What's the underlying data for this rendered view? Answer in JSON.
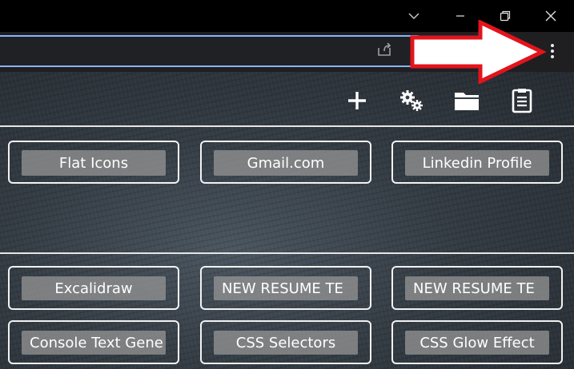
{
  "window_controls": [
    {
      "name": "tab-search",
      "icon": "chevron-down-icon"
    },
    {
      "name": "minimize",
      "icon": "minimize-icon"
    },
    {
      "name": "restore",
      "icon": "restore-icon"
    },
    {
      "name": "close",
      "icon": "close-icon"
    }
  ],
  "toolbar": {
    "share_icon": "share-icon",
    "menu_icon": "vertical-dots-icon"
  },
  "tools": [
    {
      "name": "add",
      "icon": "plus-icon"
    },
    {
      "name": "settings",
      "icon": "gears-icon"
    },
    {
      "name": "folder",
      "icon": "folder-icon"
    },
    {
      "name": "notes",
      "icon": "clipboard-icon"
    }
  ],
  "shortcuts_top": [
    {
      "label": "Flat Icons"
    },
    {
      "label": "Gmail.com"
    },
    {
      "label": "Linkedin Profile"
    }
  ],
  "shortcuts_bottom": [
    {
      "label": "Excalidraw"
    },
    {
      "label": "NEW RESUME TE"
    },
    {
      "label": "NEW RESUME TE"
    },
    {
      "label": "Console Text Gene"
    },
    {
      "label": "CSS Selectors"
    },
    {
      "label": "CSS Glow Effect"
    }
  ],
  "colors": {
    "annotation_arrow": "#e3141c",
    "omnibox_focus": "#8ab4f8"
  }
}
